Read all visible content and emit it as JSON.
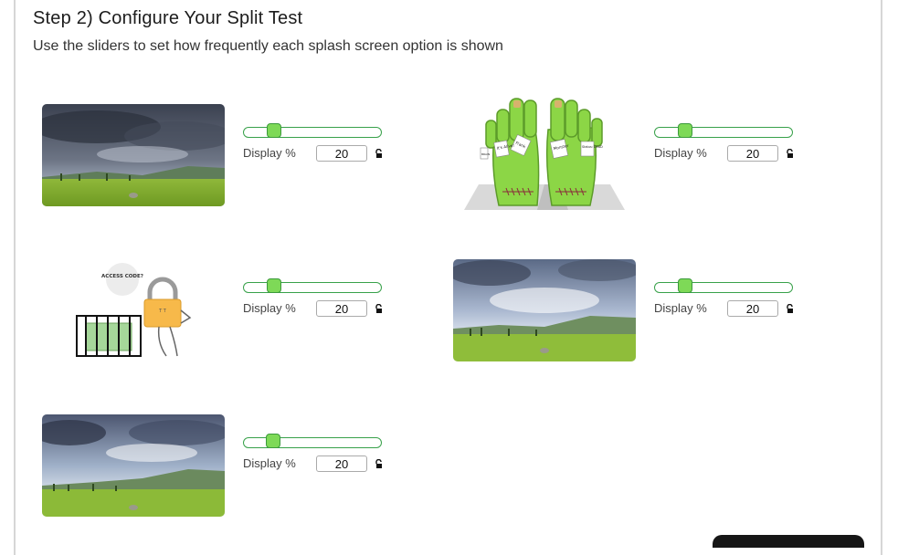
{
  "header": {
    "title": "Step 2) Configure Your Split Test",
    "subtitle": "Use the sliders to set how frequently each splash screen option is shown"
  },
  "options": [
    {
      "image": "storm-landscape-dark",
      "display_label": "Display %",
      "display_value": "20",
      "slider_fraction": 0.2,
      "lock_icon": "lock-icon"
    },
    {
      "image": "zombie-feet-illustration",
      "display_label": "Display %",
      "display_value": "20",
      "slider_fraction": 0.2,
      "lock_icon": "lock-icon",
      "tags": [
        "It's Alive!",
        "Frank",
        "Monster",
        "Status: DEAD",
        "BRAIN"
      ]
    },
    {
      "image": "padlock-access-illustration",
      "display_label": "Display %",
      "display_value": "20",
      "slider_fraction": 0.2,
      "lock_icon": "lock-icon",
      "speech_bubble": "ACCESS CODE?"
    },
    {
      "image": "storm-landscape-bright",
      "display_label": "Display %",
      "display_value": "20",
      "slider_fraction": 0.2,
      "lock_icon": "lock-icon"
    },
    {
      "image": "storm-landscape-wide",
      "display_label": "Display %",
      "display_value": "20",
      "slider_fraction": 0.2,
      "lock_icon": "lock-icon"
    }
  ],
  "colors": {
    "slider_border": "#38a14a",
    "slider_knob": "#7ed957"
  }
}
